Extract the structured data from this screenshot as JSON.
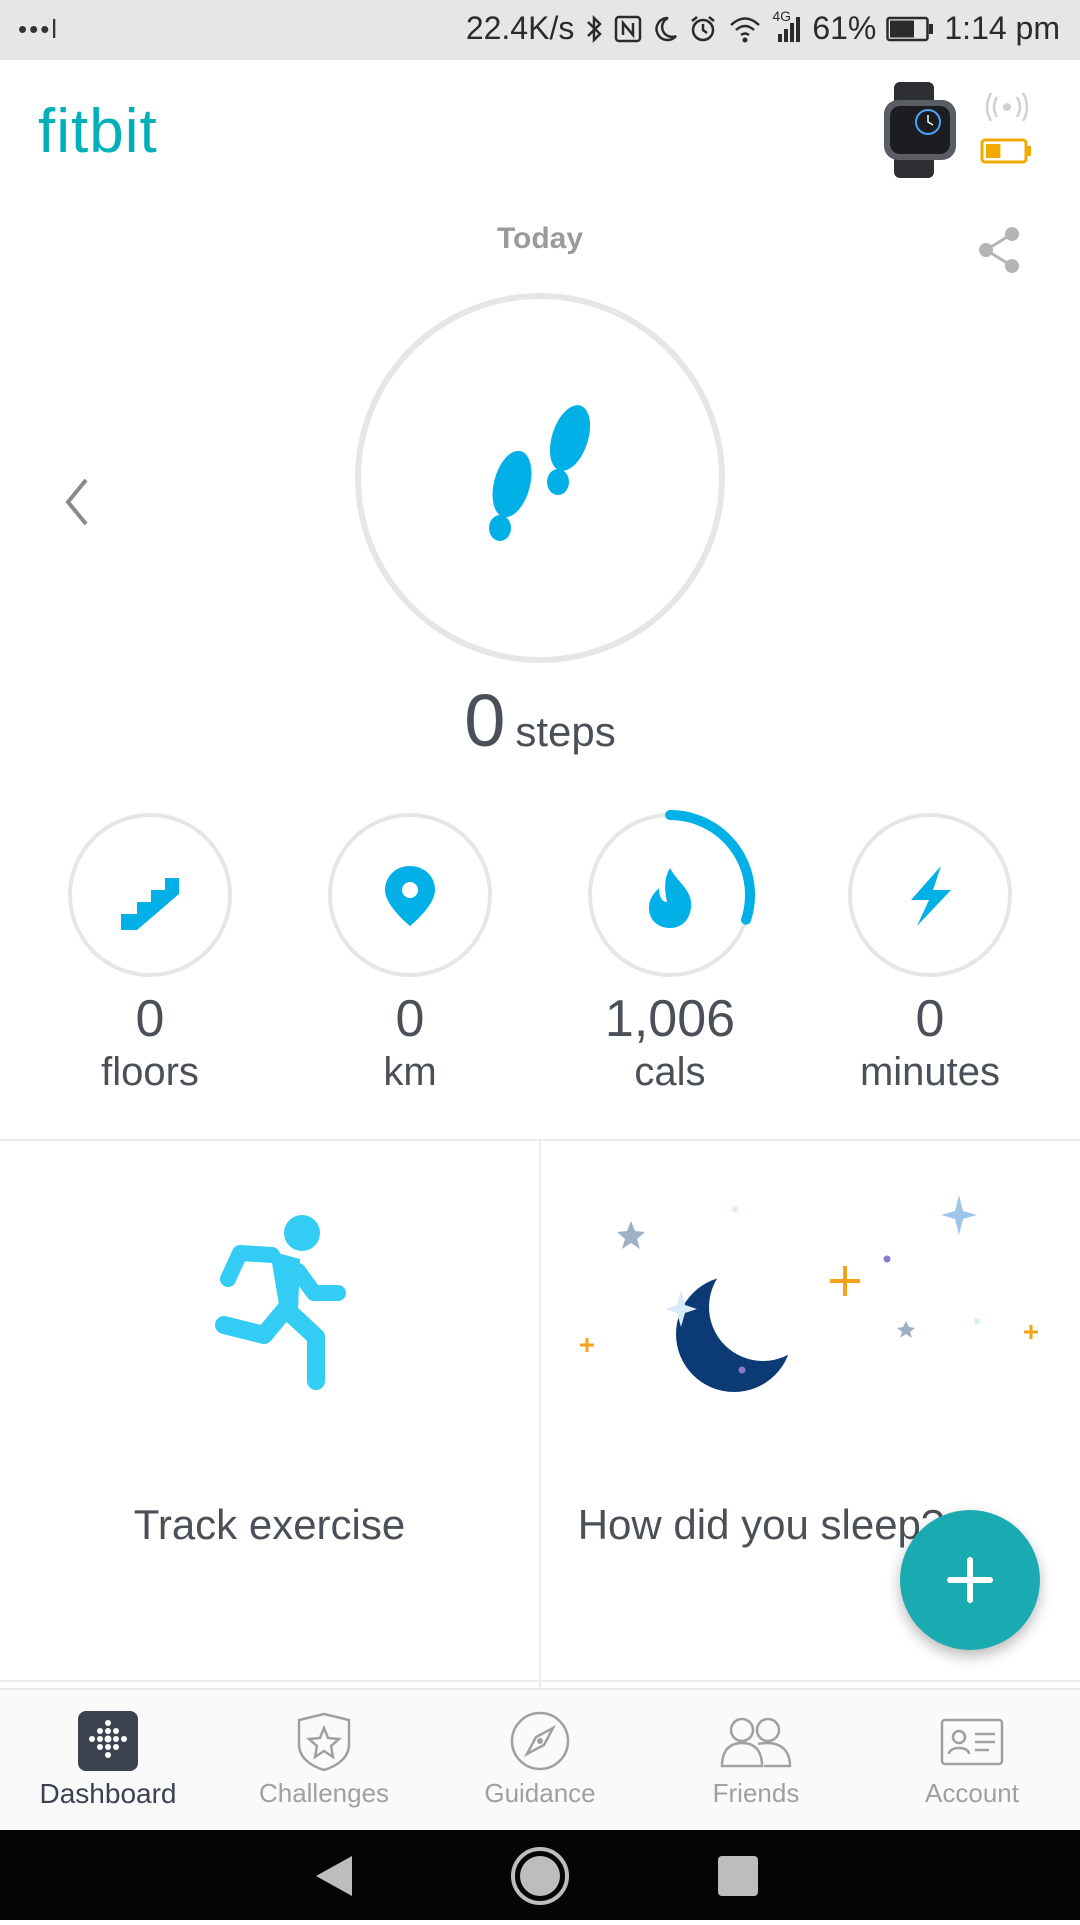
{
  "status_bar": {
    "left": "•••l",
    "net_speed": "22.4K/s",
    "network": "4G",
    "battery_percent": "61%",
    "time": "1:14 pm"
  },
  "header": {
    "logo": "fitbit",
    "device_battery_level": 0.4
  },
  "today": {
    "label": "Today",
    "steps_value": "0",
    "steps_unit": "steps"
  },
  "stats": [
    {
      "value": "0",
      "unit": "floors",
      "icon": "stairs-icon",
      "progress": 0
    },
    {
      "value": "0",
      "unit": "km",
      "icon": "location-pin-icon",
      "progress": 0
    },
    {
      "value": "1,006",
      "unit": "cals",
      "icon": "flame-icon",
      "progress": 0.3
    },
    {
      "value": "0",
      "unit": "minutes",
      "icon": "lightning-icon",
      "progress": 0
    }
  ],
  "tiles": {
    "exercise_label": "Track exercise",
    "sleep_label": "How did you sleep?"
  },
  "nav": {
    "items": [
      {
        "label": "Dashboard",
        "icon": "dashboard-icon",
        "active": true
      },
      {
        "label": "Challenges",
        "icon": "challenges-icon",
        "active": false
      },
      {
        "label": "Guidance",
        "icon": "compass-icon",
        "active": false
      },
      {
        "label": "Friends",
        "icon": "friends-icon",
        "active": false
      },
      {
        "label": "Account",
        "icon": "account-card-icon",
        "active": false
      }
    ]
  },
  "colors": {
    "accent": "#00b0b9",
    "stat_blue": "#00b0e6",
    "fab": "#1aaab1",
    "moon": "#0b3a75",
    "device_battery": "#f2a900"
  }
}
